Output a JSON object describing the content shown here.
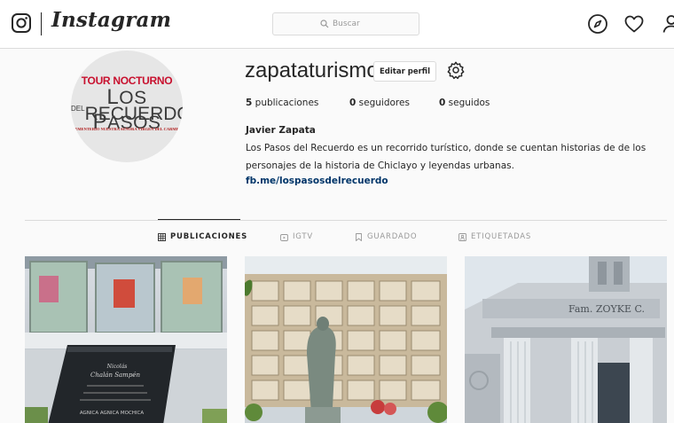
{
  "nav": {
    "wordmark": "Instagram",
    "search_placeholder": "Buscar",
    "icons": [
      "instagram-glyph-icon",
      "compass-icon",
      "heart-icon",
      "user-icon"
    ]
  },
  "profile": {
    "username": "zapataturismo",
    "edit_label": "Editar perfil",
    "stats": [
      {
        "count": "5",
        "label": "publicaciones"
      },
      {
        "count": "0",
        "label": "seguidores"
      },
      {
        "count": "0",
        "label": "seguidos"
      }
    ],
    "full_name": "Javier Zapata",
    "bio": "Los Pasos del Recuerdo es un recorrido turístico, donde se cuentan historias de de los personajes de la historia de Chiclayo y leyendas urbanas.",
    "link": "fb.me/lospasosdelrecuerdo",
    "avatar_text": {
      "line1": "TOUR NOCTURNO",
      "line2a": "L",
      "line2b": "OS ",
      "line2c": "P",
      "line2d": "ASOS",
      "line3a": "DEL",
      "line3b": "RECUERDO",
      "line4": "CEMENTERIO NUESTRA SEÑORA VIRGEN DEL CARMEN"
    }
  },
  "tabs": [
    {
      "label": "PUBLICACIONES",
      "icon": "grid-icon",
      "active": true
    },
    {
      "label": "IGTV",
      "icon": "igtv-icon",
      "active": false
    },
    {
      "label": "GUARDADO",
      "icon": "bookmark-icon",
      "active": false
    },
    {
      "label": "ETIQUETADAS",
      "icon": "tagged-icon",
      "active": false
    }
  ],
  "posts": [
    {
      "subject": "tombstone",
      "plaque_text": "AGNICA AGNICA MOCHICA"
    },
    {
      "subject": "niches with virgin statue"
    },
    {
      "subject": "mausoleum",
      "inscription": "Fam. ZOYKE C."
    }
  ],
  "colors": {
    "link": "#003569",
    "border": "#dbdbdb",
    "muted": "#999999",
    "text": "#262626",
    "logo_red": "#c8102e"
  }
}
